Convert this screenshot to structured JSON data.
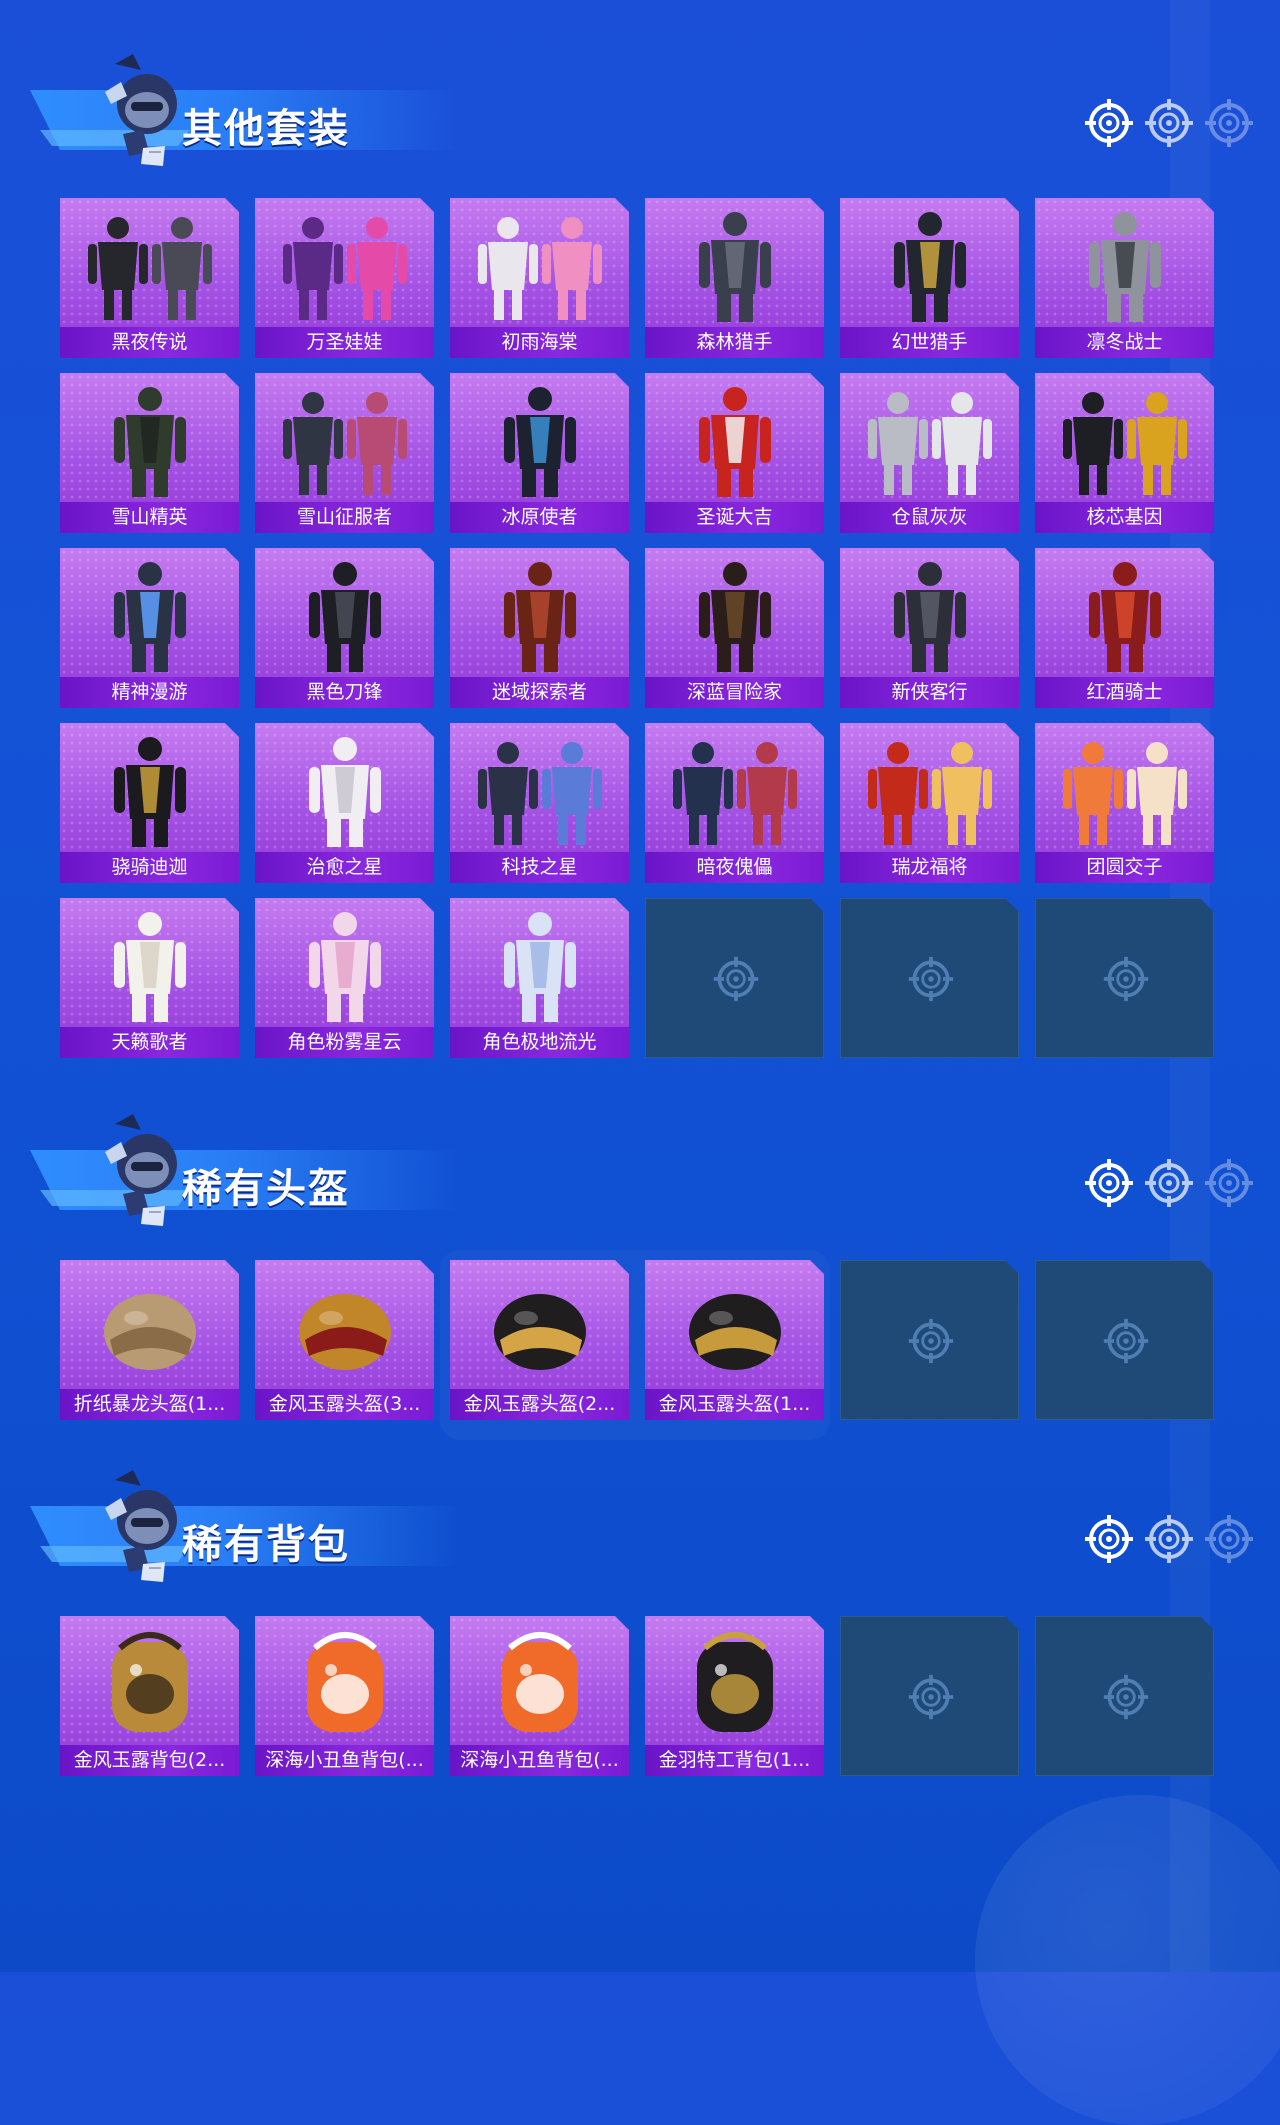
{
  "sections": [
    {
      "title": "其他套装",
      "items": [
        {
          "label": "黑夜传说",
          "art": "dark-suit-pair"
        },
        {
          "label": "万圣娃娃",
          "art": "halloween-doll-pair"
        },
        {
          "label": "初雨海棠",
          "art": "white-pink-pair"
        },
        {
          "label": "森林猎手",
          "art": "forest-hunter"
        },
        {
          "label": "幻世猎手",
          "art": "hooded-hunter"
        },
        {
          "label": "凛冬战士",
          "art": "winter-camo-soldier"
        },
        {
          "label": "雪山精英",
          "art": "green-coat-outfit"
        },
        {
          "label": "雪山征服者",
          "art": "snow-conqueror-pair"
        },
        {
          "label": "冰原使者",
          "art": "ice-envoy"
        },
        {
          "label": "圣诞大吉",
          "art": "christmas-outfit"
        },
        {
          "label": "仓鼠灰灰",
          "art": "hamster-costume-pair"
        },
        {
          "label": "核芯基因",
          "art": "core-gene-pair"
        },
        {
          "label": "精神漫游",
          "art": "armored-mech-suit"
        },
        {
          "label": "黑色刀锋",
          "art": "black-blade-armor"
        },
        {
          "label": "迷域探索者",
          "art": "red-long-coat"
        },
        {
          "label": "深蓝冒险家",
          "art": "dark-long-coat"
        },
        {
          "label": "新侠客行",
          "art": "dark-robe"
        },
        {
          "label": "红酒骑士",
          "art": "red-knight-armor"
        },
        {
          "label": "骁骑迪迦",
          "art": "tiga-hero-suit"
        },
        {
          "label": "治愈之星",
          "art": "white-nurse-outfit"
        },
        {
          "label": "科技之星",
          "art": "tech-armor-pair"
        },
        {
          "label": "暗夜傀儡",
          "art": "night-puppet-pair"
        },
        {
          "label": "瑞龙福将",
          "art": "red-dragon-general-pair"
        },
        {
          "label": "团圆交子",
          "art": "orange-festival-dress-pair"
        },
        {
          "label": "天籁歌者",
          "art": "white-singer-outfit"
        },
        {
          "label": "角色粉雾星云",
          "art": "pink-dress-character"
        },
        {
          "label": "角色极地流光",
          "art": "blue-dress-character"
        }
      ],
      "empty_slots": 3
    },
    {
      "title": "稀有头盔",
      "items": [
        {
          "label": "折纸暴龙头盔(1...",
          "art": "origami-helmet"
        },
        {
          "label": "金风玉露头盔(3...",
          "art": "golden-plumed-helmet"
        },
        {
          "label": "金风玉露头盔(2...",
          "art": "gold-horned-helmet"
        },
        {
          "label": "金风玉露头盔(1...",
          "art": "black-gold-helmet"
        }
      ],
      "empty_slots": 2
    },
    {
      "title": "稀有背包",
      "items": [
        {
          "label": "金风玉露背包(2...",
          "art": "gold-ornate-backpack"
        },
        {
          "label": "深海小丑鱼背包(...",
          "art": "clownfish-backpack"
        },
        {
          "label": "深海小丑鱼背包(...",
          "art": "clownfish-backpack"
        },
        {
          "label": "金羽特工背包(1...",
          "art": "black-gold-backpack"
        }
      ],
      "empty_slots": 2
    }
  ],
  "icons": {
    "header_decoration": [
      "crosshair-icon",
      "crosshair-icon",
      "crosshair-icon"
    ],
    "empty_slot": "crosshair-icon",
    "mascot": "mascot-character"
  },
  "colors": {
    "background": "#1352d6",
    "card_fill": "#a452e4",
    "label_bar": "#7a1ad4",
    "empty_slot": "#1f4a78",
    "ribbon": "#2f8dff"
  }
}
